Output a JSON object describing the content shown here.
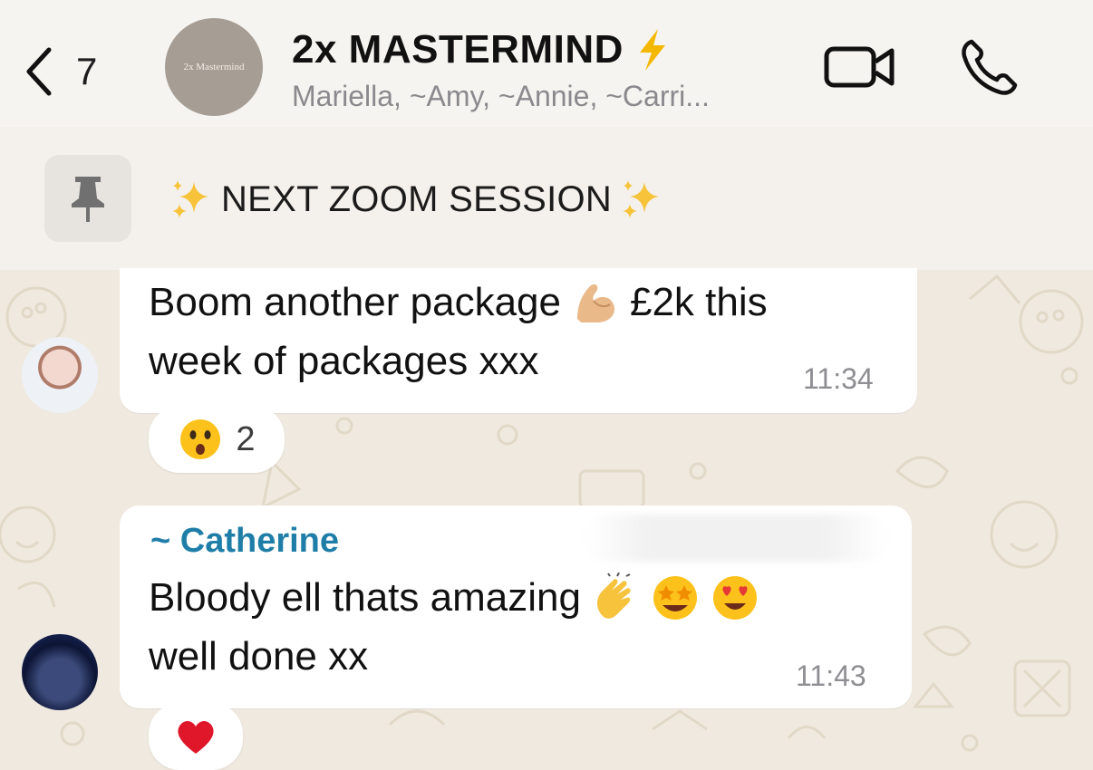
{
  "header": {
    "back_count": "7",
    "avatar_text": "2x Mastermind",
    "title": "2x MASTERMIND",
    "members": "Mariella, ~Amy, ~Annie, ~Carri...",
    "icons": [
      "chevron-left-icon",
      "lightning-icon",
      "video-call-icon",
      "phone-icon"
    ]
  },
  "pinned": {
    "text": "NEXT ZOOM SESSION",
    "icons": [
      "pin-icon",
      "sparkles-icon"
    ]
  },
  "messages": [
    {
      "line1": "Boom another package",
      "line1_after": "£2k this",
      "line2": "week of packages xxx",
      "time": "11:34",
      "reaction": {
        "emoji": "astonished-face",
        "count": "2"
      }
    },
    {
      "sender": "~ Catherine",
      "line1": "Bloody ell thats amazing",
      "line2": "well done xx",
      "time": "11:43",
      "reaction": {
        "emoji": "red-heart"
      }
    }
  ],
  "colors": {
    "sender": "#1f7ea8",
    "lightning": "#f5b800",
    "bubble": "#ffffff",
    "wallpaper": "#efe9df"
  }
}
